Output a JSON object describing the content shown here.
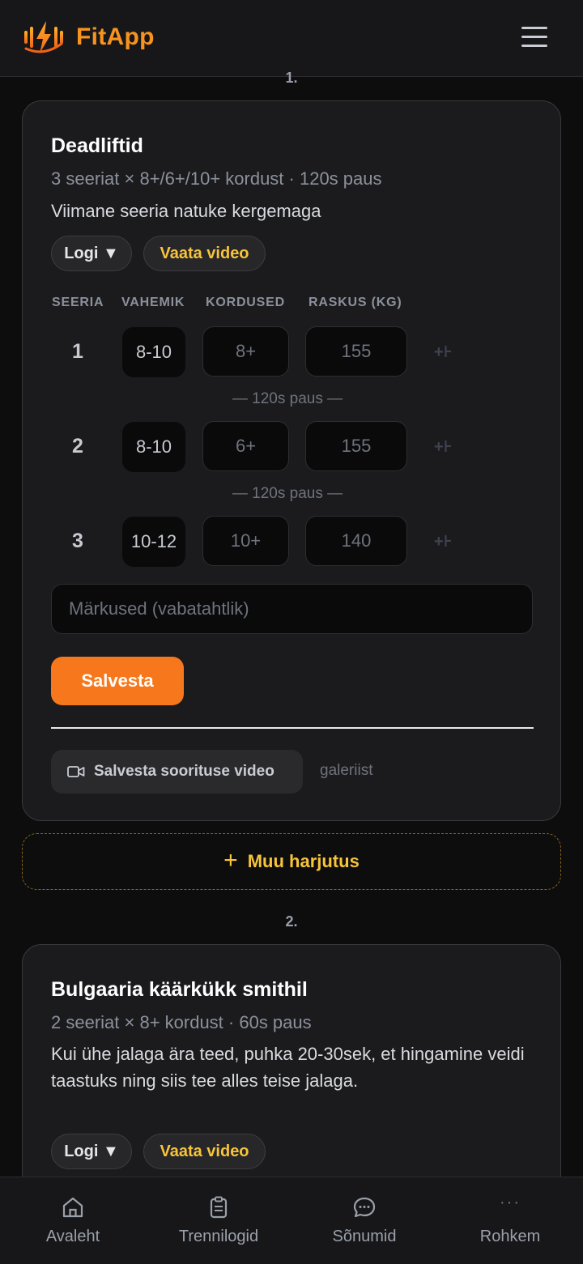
{
  "app": {
    "name": "FitApp"
  },
  "exercises": [
    {
      "index": "1.",
      "title": "Deadliftid",
      "summary": "3 seeriat × 8+/6+/10+ kordust · 120s paus",
      "note": "Viimane seeria natuke kergemaga",
      "log_label": "Logi ▼",
      "video_label": "Vaata video",
      "columns": [
        "SEERIA",
        "VAHEMIK",
        "KORDUSED",
        "RASKUS (KG)"
      ],
      "sets": [
        {
          "num": "1",
          "range": "8-10",
          "reps_placeholder": "8+",
          "kg_placeholder": "155"
        },
        {
          "num": "2",
          "range": "8-10",
          "reps_placeholder": "6+",
          "kg_placeholder": "155"
        },
        {
          "num": "3",
          "range": "10-12",
          "reps_placeholder": "10+",
          "kg_placeholder": "140"
        }
      ],
      "rest_label": "— 120s paus —",
      "add_set_glyph": "+⊦",
      "notes_placeholder": "Märkused (vabatahtlik)",
      "save_label": "Salvesta",
      "save_video_label": "Salvesta soorituse video",
      "gallery_label": "galeriist"
    },
    {
      "index": "2.",
      "title": "Bulgaaria käärkükk smithil",
      "summary": "2 seeriat × 8+ kordust · 60s paus",
      "note": "Kui ühe jalaga ära teed, puhka 20-30sek, et hingamine veidi taastuks ning siis tee alles teise jalaga.",
      "log_label": "Logi ▼",
      "video_label": "Vaata video"
    }
  ],
  "add_exercise": {
    "plus": "+",
    "label": "Muu harjutus"
  },
  "nav": [
    {
      "label": "Avaleht",
      "icon": "home-icon"
    },
    {
      "label": "Trennilogid",
      "icon": "clipboard-icon"
    },
    {
      "label": "Sõnumid",
      "icon": "chat-icon"
    },
    {
      "label": "Rohkem",
      "icon": "more-dots-icon",
      "glyph": "···"
    }
  ],
  "colors": {
    "accent": "#f7781c",
    "brand": "#f7931e",
    "highlight": "#f8c43a",
    "background": "#0d0d0e",
    "card": "#1b1b1d"
  }
}
